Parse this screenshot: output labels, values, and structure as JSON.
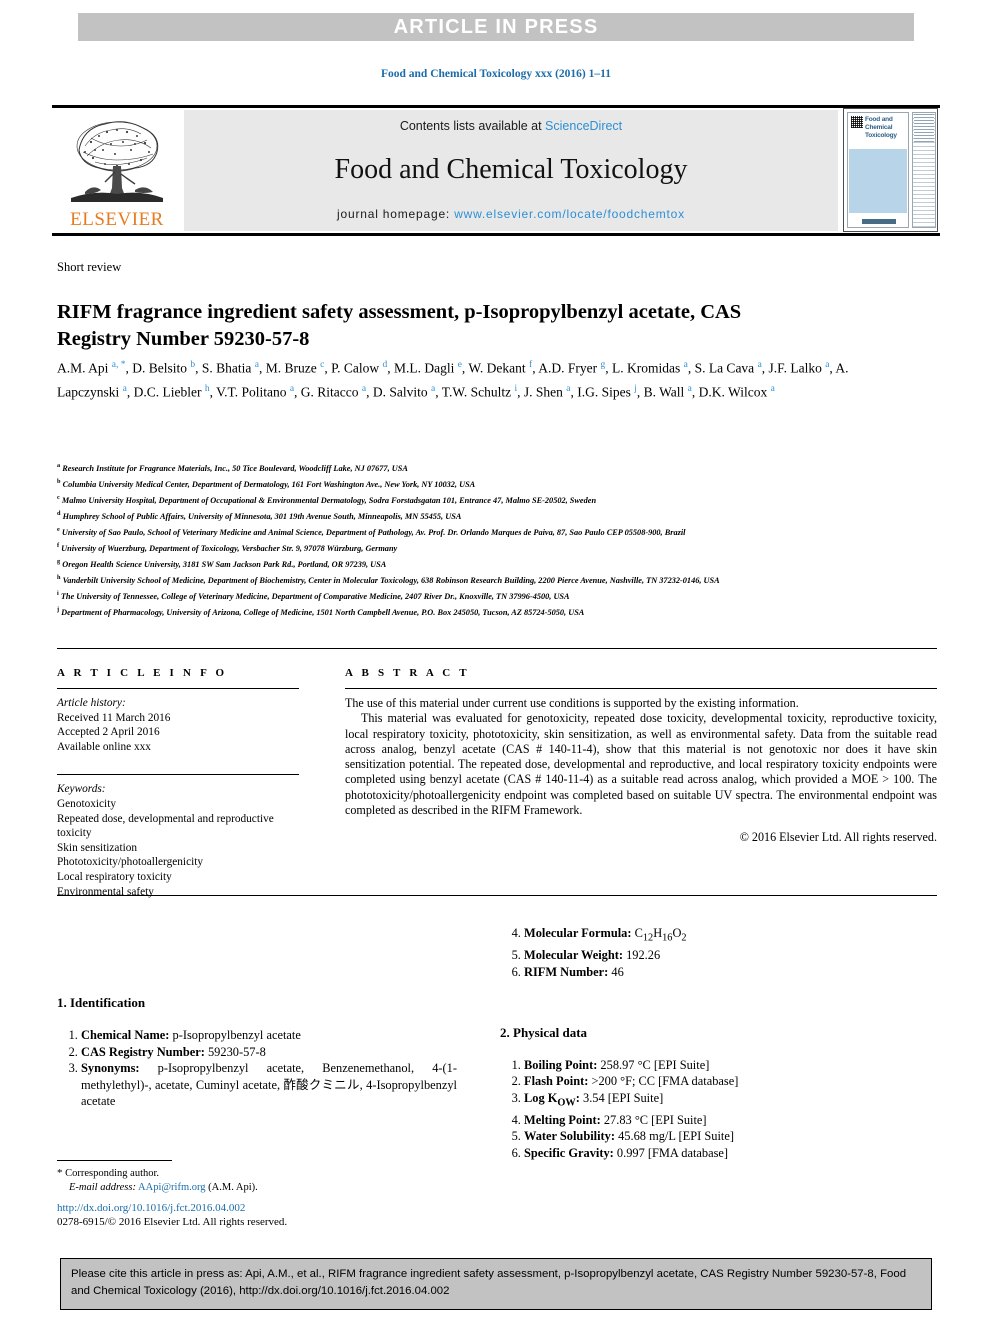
{
  "banner": {
    "text": "ARTICLE IN PRESS"
  },
  "journal_ref": "Food and Chemical Toxicology xxx (2016) 1–11",
  "masthead": {
    "contents_prefix": "Contents lists available at ",
    "sciencedirect": "ScienceDirect",
    "journal_title": "Food and Chemical Toxicology",
    "homepage_prefix": "journal homepage: ",
    "homepage_url": "www.elsevier.com/locate/foodchemtox",
    "publisher": "ELSEVIER",
    "cover_title": "Food and Chemical Toxicology"
  },
  "article": {
    "type": "Short review",
    "title": "RIFM fragrance ingredient safety assessment, p-Isopropylbenzyl acetate, CAS Registry Number 59230-57-8",
    "authors_html": "A.M. Api <sup>a, *</sup>, D. Belsito <sup>b</sup>, S. Bhatia <sup>a</sup>, M. Bruze <sup>c</sup>, P. Calow <sup>d</sup>, M.L. Dagli <sup>e</sup>, W. Dekant <sup>f</sup>, A.D. Fryer <sup>g</sup>, L. Kromidas <sup>a</sup>, S. La Cava <sup>a</sup>, J.F. Lalko <sup>a</sup>, A. Lapczynski <sup>a</sup>, D.C. Liebler <sup>h</sup>, V.T. Politano <sup>a</sup>, G. Ritacco <sup>a</sup>, D. Salvito <sup>a</sup>, T.W. Schultz <sup>i</sup>, J. Shen <sup>a</sup>, I.G. Sipes <sup>j</sup>, B. Wall <sup>a</sup>, D.K. Wilcox <sup>a</sup>"
  },
  "affiliations": [
    {
      "mark": "a",
      "text": "Research Institute for Fragrance Materials, Inc., 50 Tice Boulevard, Woodcliff Lake, NJ 07677, USA"
    },
    {
      "mark": "b",
      "text": "Columbia University Medical Center, Department of Dermatology, 161 Fort Washington Ave., New York, NY 10032, USA"
    },
    {
      "mark": "c",
      "text": "Malmo University Hospital, Department of Occupational & Environmental Dermatology, Sodra Forstadsgatan 101, Entrance 47, Malmo SE-20502, Sweden"
    },
    {
      "mark": "d",
      "text": "Humphrey School of Public Affairs, University of Minnesota, 301 19th Avenue South, Minneapolis, MN 55455, USA"
    },
    {
      "mark": "e",
      "text": "University of Sao Paulo, School of Veterinary Medicine and Animal Science, Department of Pathology, Av. Prof. Dr. Orlando Marques de Paiva, 87, Sao Paulo CEP 05508-900, Brazil"
    },
    {
      "mark": "f",
      "text": "University of Wuerzburg, Department of Toxicology, Versbacher Str. 9, 97078 Würzburg, Germany"
    },
    {
      "mark": "g",
      "text": "Oregon Health Science University, 3181 SW Sam Jackson Park Rd., Portland, OR 97239, USA"
    },
    {
      "mark": "h",
      "text": "Vanderbilt University School of Medicine, Department of Biochemistry, Center in Molecular Toxicology, 638 Robinson Research Building, 2200 Pierce Avenue, Nashville, TN 37232-0146, USA"
    },
    {
      "mark": "i",
      "text": "The University of Tennessee, College of Veterinary Medicine, Department of Comparative Medicine, 2407 River Dr., Knoxville, TN 37996-4500, USA"
    },
    {
      "mark": "j",
      "text": "Department of Pharmacology, University of Arizona, College of Medicine, 1501 North Campbell Avenue, P.O. Box 245050, Tucson, AZ 85724-5050, USA"
    }
  ],
  "article_info": {
    "heading": "A R T I C L E  I N F O",
    "history_label": "Article history:",
    "history": [
      "Received 11 March 2016",
      "Accepted 2 April 2016",
      "Available online xxx"
    ],
    "keywords_label": "Keywords:",
    "keywords": [
      "Genotoxicity",
      "Repeated dose, developmental and reproductive toxicity",
      "Skin sensitization",
      "Phototoxicity/photoallergenicity",
      "Local respiratory toxicity",
      "Environmental safety"
    ]
  },
  "abstract": {
    "heading": "A B S T R A C T",
    "para1": "The use of this material under current use conditions is supported by the existing information.",
    "para2": "This material was evaluated for genotoxicity, repeated dose toxicity, developmental toxicity, reproductive toxicity, local respiratory toxicity, phototoxicity, skin sensitization, as well as environmental safety. Data from the suitable read across analog, benzyl acetate (CAS # 140-11-4), show that this material is not genotoxic nor does it have skin sensitization potential. The repeated dose, developmental and reproductive, and local respiratory toxicity endpoints were completed using benzyl acetate (CAS # 140-11-4) as a suitable read across analog, which provided a MOE > 100. The phototoxicity/photoallergenicity endpoint was completed based on suitable UV spectra. The environmental endpoint was completed as described in the RIFM Framework.",
    "copyright": "© 2016 Elsevier Ltd. All rights reserved."
  },
  "identification": {
    "heading": "1.  Identification",
    "items": [
      {
        "label": "Chemical Name:",
        "value": " p-Isopropylbenzyl acetate"
      },
      {
        "label": "CAS Registry Number:",
        "value": " 59230-57-8"
      },
      {
        "label": "Synonyms:",
        "value": " p-Isopropylbenzyl acetate, Benzenemethanol, 4-(1-methylethyl)-, acetate, Cuminyl acetate, 酢酸クミニル, 4-Isopropylbenzyl acetate"
      }
    ],
    "items_right": [
      {
        "num": "4.",
        "label": "Molecular Formula:",
        "value_html": " C<sub>12</sub>H<sub>16</sub>O<sub>2</sub>"
      },
      {
        "num": "5.",
        "label": "Molecular Weight:",
        "value_html": " 192.26"
      },
      {
        "num": "6.",
        "label": "RIFM Number:",
        "value_html": " 46"
      }
    ]
  },
  "physical_data": {
    "heading": "2.  Physical data",
    "items": [
      {
        "label": "Boiling Point:",
        "value_html": " 258.97 °C [EPI Suite]"
      },
      {
        "label": "Flash Point:",
        "value_html": " >200 °F; CC [FMA database]"
      },
      {
        "label": "Log K<sub>OW</sub>:",
        "value_html": " 3.54 [EPI Suite]"
      },
      {
        "label": "Melting Point:",
        "value_html": " 27.83 °C [EPI Suite]"
      },
      {
        "label": "Water Solubility:",
        "value_html": " 45.68 mg/L [EPI Suite]"
      },
      {
        "label": "Specific Gravity:",
        "value_html": " 0.997 [FMA database]"
      }
    ]
  },
  "footnote": {
    "corresponding": "Corresponding author.",
    "email_label": "E-mail address:",
    "email": "AApi@rifm.org",
    "email_owner": "(A.M. Api).",
    "doi": "http://dx.doi.org/10.1016/j.fct.2016.04.002",
    "issn": "0278-6915/© 2016 Elsevier Ltd. All rights reserved."
  },
  "cite_box": {
    "text": "Please cite this article in press as: Api, A.M., et al., RIFM fragrance ingredient safety assessment, p-Isopropylbenzyl acetate, CAS Registry Number 59230-57-8, Food and Chemical Toxicology (2016), http://dx.doi.org/10.1016/j.fct.2016.04.002"
  },
  "colors": {
    "banner_gray": "#c2c2c2",
    "link_blue": "#1b6ca8",
    "sd_blue": "#2d8fd5",
    "elsevier_orange": "#E87B20",
    "masthead_gray": "#e8e8e8"
  }
}
